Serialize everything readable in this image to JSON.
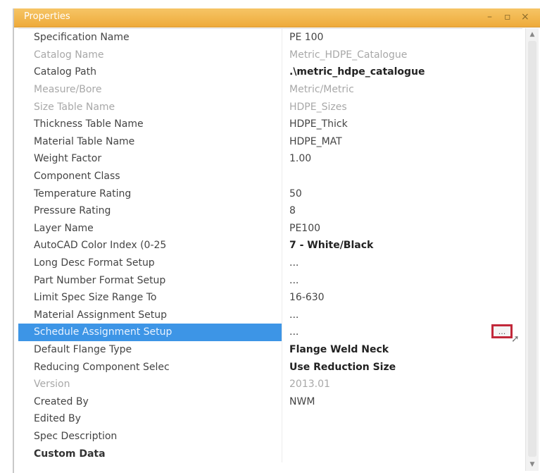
{
  "panel": {
    "title": "Properties",
    "controls": [
      "–",
      "▫",
      "×"
    ]
  },
  "rows": [
    {
      "name": "Specification Name",
      "value": "PE 100",
      "style": ""
    },
    {
      "name": "Catalog Name",
      "value": "Metric_HDPE_Catalogue",
      "style": "dim"
    },
    {
      "name": "Catalog Path",
      "value": ".\\metric_hdpe_catalogue",
      "style": "bold"
    },
    {
      "name": "Measure/Bore",
      "value": "Metric/Metric",
      "style": "dim"
    },
    {
      "name": "Size Table Name",
      "value": "HDPE_Sizes",
      "style": "dim"
    },
    {
      "name": "Thickness Table Name",
      "value": "HDPE_Thick",
      "style": ""
    },
    {
      "name": "Material Table Name",
      "value": "HDPE_MAT",
      "style": ""
    },
    {
      "name": "Weight Factor",
      "value": "1.00",
      "style": ""
    },
    {
      "name": "Component Class",
      "value": "",
      "style": ""
    },
    {
      "name": "Temperature Rating",
      "value": "50",
      "style": ""
    },
    {
      "name": "Pressure Rating",
      "value": "8",
      "style": ""
    },
    {
      "name": "Layer Name",
      "value": "PE100",
      "style": ""
    },
    {
      "name": "AutoCAD Color Index (0-25",
      "value": "7 - White/Black",
      "style": "bold"
    },
    {
      "name": "Long Desc Format Setup",
      "value": "...",
      "style": ""
    },
    {
      "name": "Part Number Format Setup",
      "value": "...",
      "style": ""
    },
    {
      "name": "Limit Spec Size Range To",
      "value": "16-630",
      "style": ""
    },
    {
      "name": "Material Assignment Setup",
      "value": "...",
      "style": ""
    },
    {
      "name": "Schedule Assignment Setup",
      "value": "...",
      "style": "selected"
    },
    {
      "name": "Default Flange Type",
      "value": "Flange Weld Neck",
      "style": "bold"
    },
    {
      "name": "Reducing Component Selec",
      "value": "Use Reduction Size",
      "style": "bold"
    },
    {
      "name": "Version",
      "value": "2013.01",
      "style": "dim"
    },
    {
      "name": "Created By",
      "value": "NWM",
      "style": ""
    },
    {
      "name": "Edited By",
      "value": "",
      "style": ""
    },
    {
      "name": "Spec Description",
      "value": "",
      "style": ""
    },
    {
      "name": "Custom Data",
      "value": "",
      "style": "category"
    }
  ],
  "ellipsis_button": {
    "label": "..."
  },
  "scrollbar": {
    "up": "▲",
    "down": "▼"
  }
}
